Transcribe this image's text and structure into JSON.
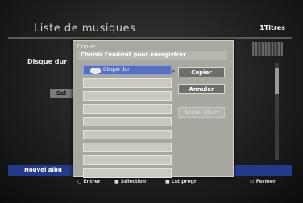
{
  "screen": {
    "title": "Liste de musiques",
    "count": "1Titres",
    "side_label": "Disque dur",
    "side_button": "Sel",
    "bottom_label": "Nouvel albu"
  },
  "dialog": {
    "caption": "Copier",
    "header": "Choisir l'endroit pour enregistrer",
    "items": [
      {
        "label": "Disque dur",
        "selected": true
      },
      {
        "label": "",
        "selected": false
      },
      {
        "label": "",
        "selected": false
      },
      {
        "label": "",
        "selected": false
      },
      {
        "label": "",
        "selected": false
      },
      {
        "label": "",
        "selected": false
      },
      {
        "label": "",
        "selected": false
      },
      {
        "label": "",
        "selected": false
      },
      {
        "label": "",
        "selected": false
      },
      {
        "label": "",
        "selected": false
      }
    ],
    "buttons": {
      "copy": "Copier",
      "cancel": "Annuler",
      "new_folder": "Nouvel album"
    }
  },
  "footer": {
    "enter": "Entrer",
    "select": "Sélection",
    "list": "Lst progr",
    "close": "Fermer"
  }
}
